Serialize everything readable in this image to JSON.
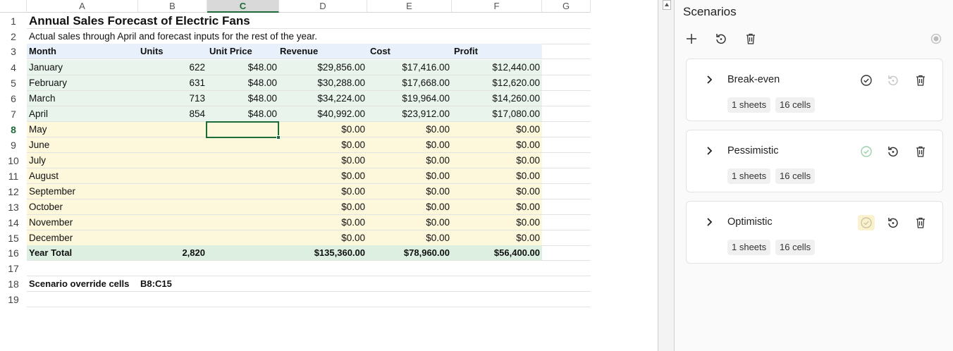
{
  "sheet": {
    "columns": [
      "A",
      "B",
      "C",
      "D",
      "E",
      "F",
      "G"
    ],
    "selected_column": "C",
    "selected_row": "8",
    "rows": [
      {
        "n": "1",
        "a": "Annual Sales Forecast of Electric Fans"
      },
      {
        "n": "2",
        "a": "Actual sales through April and forecast inputs for the rest of the year."
      },
      {
        "n": "3",
        "a": "Month",
        "b": "Units",
        "c": "Unit Price",
        "d": "Revenue",
        "e": "Cost",
        "f": "Profit"
      },
      {
        "n": "4",
        "a": "January",
        "b": "622",
        "c": "$48.00",
        "d": "$29,856.00",
        "e": "$17,416.00",
        "f": "$12,440.00"
      },
      {
        "n": "5",
        "a": "February",
        "b": "631",
        "c": "$48.00",
        "d": "$30,288.00",
        "e": "$17,668.00",
        "f": "$12,620.00"
      },
      {
        "n": "6",
        "a": "March",
        "b": "713",
        "c": "$48.00",
        "d": "$34,224.00",
        "e": "$19,964.00",
        "f": "$14,260.00"
      },
      {
        "n": "7",
        "a": "April",
        "b": "854",
        "c": "$48.00",
        "d": "$40,992.00",
        "e": "$23,912.00",
        "f": "$17,080.00"
      },
      {
        "n": "8",
        "a": "May",
        "d": "$0.00",
        "e": "$0.00",
        "f": "$0.00"
      },
      {
        "n": "9",
        "a": "June",
        "d": "$0.00",
        "e": "$0.00",
        "f": "$0.00"
      },
      {
        "n": "10",
        "a": "July",
        "d": "$0.00",
        "e": "$0.00",
        "f": "$0.00"
      },
      {
        "n": "11",
        "a": "August",
        "d": "$0.00",
        "e": "$0.00",
        "f": "$0.00"
      },
      {
        "n": "12",
        "a": "September",
        "d": "$0.00",
        "e": "$0.00",
        "f": "$0.00"
      },
      {
        "n": "13",
        "a": "October",
        "d": "$0.00",
        "e": "$0.00",
        "f": "$0.00"
      },
      {
        "n": "14",
        "a": "November",
        "d": "$0.00",
        "e": "$0.00",
        "f": "$0.00"
      },
      {
        "n": "15",
        "a": "December",
        "d": "$0.00",
        "e": "$0.00",
        "f": "$0.00"
      },
      {
        "n": "16",
        "a": "Year Total",
        "b": "2,820",
        "d": "$135,360.00",
        "e": "$78,960.00",
        "f": "$56,400.00"
      },
      {
        "n": "17"
      },
      {
        "n": "18",
        "a": "Scenario override cells",
        "b": "B8:C15"
      },
      {
        "n": "19"
      }
    ]
  },
  "panel": {
    "title": "Scenarios",
    "toolbar": {
      "add_icon": "plus-icon",
      "restore_icon": "restore-icon",
      "delete_icon": "trash-icon",
      "status_icon": "radio-icon"
    },
    "scenarios": [
      {
        "name": "Break-even",
        "sheets": "1 sheets",
        "cells": "16 cells",
        "applied": true
      },
      {
        "name": "Pessimistic",
        "sheets": "1 sheets",
        "cells": "16 cells",
        "applied": false
      },
      {
        "name": "Optimistic",
        "sheets": "1 sheets",
        "cells": "16 cells",
        "applied": false,
        "apply_hover": true
      }
    ]
  },
  "colors": {
    "selection": "#1e6b3a",
    "header_band": "#e8f1fb",
    "actual_band": "#e8f4ec",
    "forecast_band": "#fdf7dc",
    "total_band": "#dcefe0"
  }
}
